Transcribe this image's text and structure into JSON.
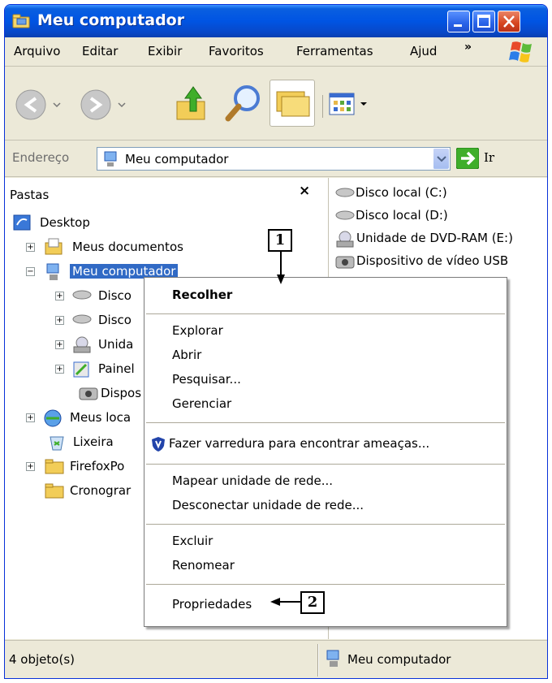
{
  "window": {
    "title": "Meu computador"
  },
  "menubar": {
    "items": [
      "Arquivo",
      "Editar",
      "Exibir",
      "Favoritos",
      "Ferramentas",
      "Ajud"
    ],
    "more": "»"
  },
  "address": {
    "label": "Endereço",
    "value": "Meu computador",
    "go_label": "Ir"
  },
  "folders_pane": {
    "title": "Pastas",
    "close_glyph": "×",
    "tree": [
      {
        "label": "Desktop"
      },
      {
        "label": "Meus documentos"
      },
      {
        "label": "Meu computador"
      },
      {
        "label": "Disco"
      },
      {
        "label": "Disco"
      },
      {
        "label": "Unida"
      },
      {
        "label": "Painel"
      },
      {
        "label": "Dispos"
      },
      {
        "label": "Meus loca"
      },
      {
        "label": "Lixeira"
      },
      {
        "label": "FirefoxPo"
      },
      {
        "label": "Cronograr"
      }
    ]
  },
  "files_pane": {
    "items": [
      {
        "label": "Disco local (C:)"
      },
      {
        "label": "Disco local (D:)"
      },
      {
        "label": "Unidade de DVD-RAM (E:)"
      },
      {
        "label": "Dispositivo de vídeo USB"
      }
    ]
  },
  "context_menu": {
    "items": [
      {
        "label": "Recolher"
      },
      {
        "label": "Explorar"
      },
      {
        "label": "Abrir"
      },
      {
        "label": "Pesquisar..."
      },
      {
        "label": "Gerenciar"
      },
      {
        "label": "Fazer varredura para encontrar ameaças..."
      },
      {
        "label": "Mapear unidade de rede..."
      },
      {
        "label": "Desconectar unidade de rede..."
      },
      {
        "label": "Excluir"
      },
      {
        "label": "Renomear"
      },
      {
        "label": "Propriedades"
      }
    ]
  },
  "callouts": {
    "one": "1",
    "two": "2"
  },
  "statusbar": {
    "left": "4 objeto(s)",
    "right": "Meu computador"
  },
  "colors": {
    "titlebar": "#0054e3",
    "selection": "#316ac5",
    "chrome": "#ece9d8"
  },
  "icons": {
    "title": "computer-folder-icon",
    "back": "back-arrow-icon",
    "forward": "forward-arrow-icon",
    "up": "folder-up-icon",
    "search": "search-icon",
    "folders": "folders-icon",
    "views": "views-icon",
    "go": "go-arrow-icon",
    "shield": "shield-icon"
  }
}
